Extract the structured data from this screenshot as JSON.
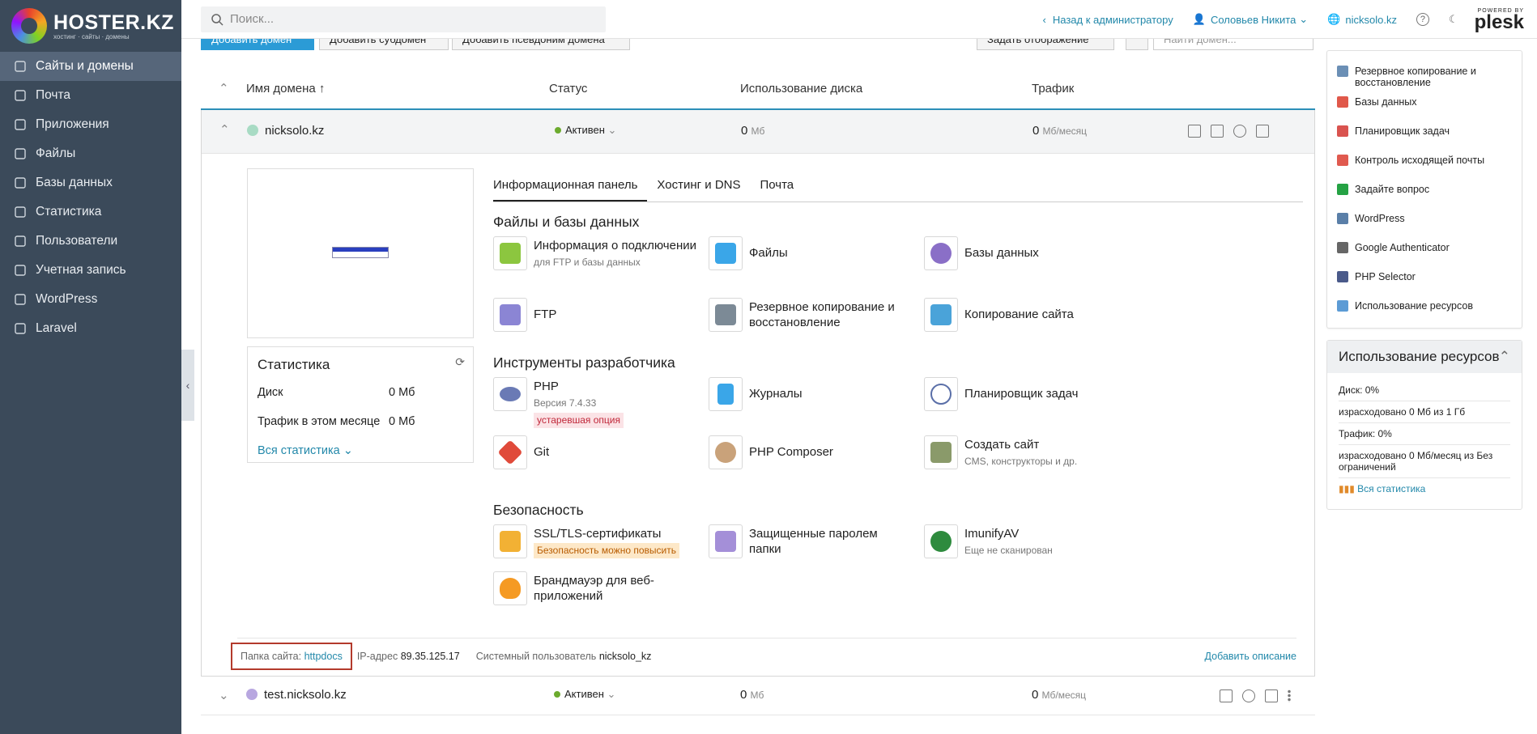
{
  "brand": {
    "title": "HOSTER.KZ",
    "subtitle": "хостинг · сайты · домены"
  },
  "sidebar": {
    "items": [
      {
        "label": "Сайты и домены",
        "icon": "monitor-icon",
        "active": true
      },
      {
        "label": "Почта",
        "icon": "mail-icon"
      },
      {
        "label": "Приложения",
        "icon": "gear-icon"
      },
      {
        "label": "Файлы",
        "icon": "folder-icon"
      },
      {
        "label": "Базы данных",
        "icon": "database-icon"
      },
      {
        "label": "Статистика",
        "icon": "chart-icon"
      },
      {
        "label": "Пользователи",
        "icon": "user-icon"
      },
      {
        "label": "Учетная запись",
        "icon": "account-icon"
      },
      {
        "label": "WordPress",
        "icon": "wordpress-icon"
      },
      {
        "label": "Laravel",
        "icon": "laravel-icon"
      }
    ]
  },
  "topbar": {
    "search_placeholder": "Поиск...",
    "back": "Назад к администратору",
    "user": "Соловьев Никита",
    "domain": "nicksolo.kz",
    "powered": "POWERED BY",
    "plesk": "plesk"
  },
  "toolbar": {
    "add_domain": "Добавить домен",
    "add_subdomain": "Добавить субдомен",
    "add_alias": "Добавить псевдоним домена",
    "view": "Задать отображение",
    "find_placeholder": "Найти домен..."
  },
  "table": {
    "col_name": "Имя домена ↑",
    "col_status": "Статус",
    "col_disk": "Использование диска",
    "col_traffic": "Трафик"
  },
  "domain1": {
    "name": "nicksolo.kz",
    "status": "Активен",
    "disk": "0",
    "disk_unit": "Мб",
    "traffic": "0",
    "traffic_unit": "Мб/месяц"
  },
  "stats": {
    "title": "Статистика",
    "disk_label": "Диск",
    "disk_val": "0 Мб",
    "traffic_label": "Трафик в этом месяце",
    "traffic_val": "0 Мб",
    "all": "Вся статистика"
  },
  "tabs": [
    "Информационная панель",
    "Хостинг и DNS",
    "Почта"
  ],
  "sections": {
    "files": "Файлы и базы данных",
    "dev": "Инструменты разработчика",
    "security": "Безопасность"
  },
  "tools": {
    "conn": "Информация о подключении",
    "conn_sub": "для FTP и базы данных",
    "files": "Файлы",
    "db": "Базы данных",
    "ftp": "FTP",
    "backup": "Резервное копирование и восстановление",
    "copy": "Копирование сайта",
    "php": "PHP",
    "php_sub": "Версия 7.4.33",
    "php_badge": "устаревшая опция",
    "logs": "Журналы",
    "cron": "Планировщик задач",
    "git": "Git",
    "composer": "PHP Composer",
    "create": "Создать сайт",
    "create_sub": "CMS, конструкторы и др.",
    "ssl": "SSL/TLS-сертификаты",
    "ssl_badge": "Безопасность можно повысить",
    "protected": "Защищенные паролем папки",
    "imunify": "ImunifyAV",
    "imunify_sub": "Еще не сканирован",
    "firewall": "Брандмауэр для веб-приложений"
  },
  "footer": {
    "folder_label": "Папка сайта:",
    "folder": "httpdocs",
    "ip_label": "IP-адрес",
    "ip": "89.35.125.17",
    "user_label": "Системный пользователь",
    "user": "nicksolo_kz",
    "add_desc": "Добавить описание"
  },
  "domain2": {
    "name": "test.nicksolo.kz",
    "status": "Активен",
    "disk": "0",
    "disk_unit": "Мб",
    "traffic": "0",
    "traffic_unit": "Мб/месяц"
  },
  "right_panel": {
    "items": [
      {
        "label": "Резервное копирование и восстановление",
        "color": "#6b8fb5"
      },
      {
        "label": "Базы данных",
        "color": "#e0584a"
      },
      {
        "label": "Планировщик задач",
        "color": "#d9534f"
      },
      {
        "label": "Контроль исходящей почты",
        "color": "#e05a4f"
      },
      {
        "label": "Задайте вопрос",
        "color": "#25a244"
      },
      {
        "label": "WordPress",
        "color": "#5a7fa8"
      },
      {
        "label": "Google Authenticator",
        "color": "#666666"
      },
      {
        "label": "PHP Selector",
        "color": "#4a5a8a"
      },
      {
        "label": "Использование ресурсов",
        "color": "#5c9bd5"
      }
    ],
    "usage_title": "Использование ресурсов",
    "disk": "Диск: 0%",
    "disk_detail": "израсходовано 0 Мб из 1 Гб",
    "traffic": "Трафик: 0%",
    "traffic_detail": "израсходовано 0 Мб/месяц из Без ограничений",
    "all_stats": "Вся статистика"
  }
}
